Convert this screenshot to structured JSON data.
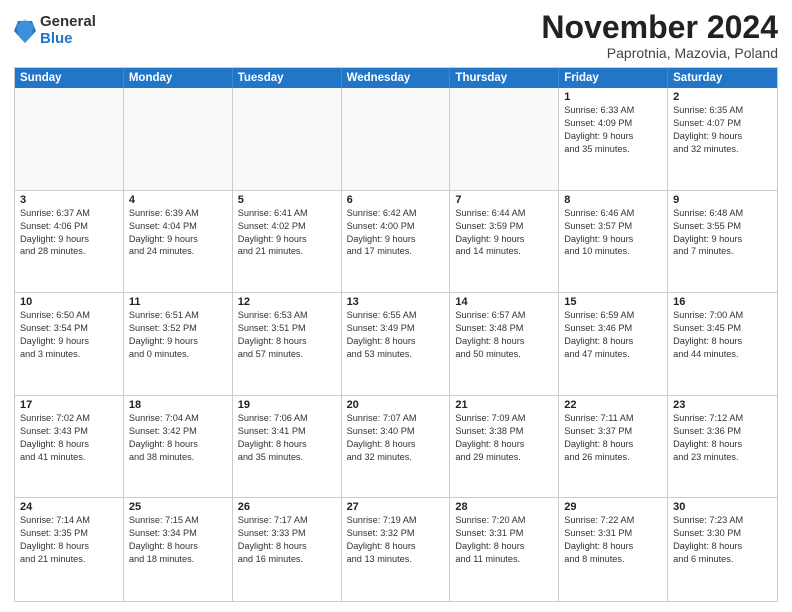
{
  "logo": {
    "general": "General",
    "blue": "Blue"
  },
  "header": {
    "month": "November 2024",
    "location": "Paprotnia, Mazovia, Poland"
  },
  "weekdays": [
    "Sunday",
    "Monday",
    "Tuesday",
    "Wednesday",
    "Thursday",
    "Friday",
    "Saturday"
  ],
  "rows": [
    [
      {
        "day": "",
        "text": "",
        "empty": true
      },
      {
        "day": "",
        "text": "",
        "empty": true
      },
      {
        "day": "",
        "text": "",
        "empty": true
      },
      {
        "day": "",
        "text": "",
        "empty": true
      },
      {
        "day": "",
        "text": "",
        "empty": true
      },
      {
        "day": "1",
        "text": "Sunrise: 6:33 AM\nSunset: 4:09 PM\nDaylight: 9 hours\nand 35 minutes.",
        "empty": false
      },
      {
        "day": "2",
        "text": "Sunrise: 6:35 AM\nSunset: 4:07 PM\nDaylight: 9 hours\nand 32 minutes.",
        "empty": false
      }
    ],
    [
      {
        "day": "3",
        "text": "Sunrise: 6:37 AM\nSunset: 4:06 PM\nDaylight: 9 hours\nand 28 minutes.",
        "empty": false
      },
      {
        "day": "4",
        "text": "Sunrise: 6:39 AM\nSunset: 4:04 PM\nDaylight: 9 hours\nand 24 minutes.",
        "empty": false
      },
      {
        "day": "5",
        "text": "Sunrise: 6:41 AM\nSunset: 4:02 PM\nDaylight: 9 hours\nand 21 minutes.",
        "empty": false
      },
      {
        "day": "6",
        "text": "Sunrise: 6:42 AM\nSunset: 4:00 PM\nDaylight: 9 hours\nand 17 minutes.",
        "empty": false
      },
      {
        "day": "7",
        "text": "Sunrise: 6:44 AM\nSunset: 3:59 PM\nDaylight: 9 hours\nand 14 minutes.",
        "empty": false
      },
      {
        "day": "8",
        "text": "Sunrise: 6:46 AM\nSunset: 3:57 PM\nDaylight: 9 hours\nand 10 minutes.",
        "empty": false
      },
      {
        "day": "9",
        "text": "Sunrise: 6:48 AM\nSunset: 3:55 PM\nDaylight: 9 hours\nand 7 minutes.",
        "empty": false
      }
    ],
    [
      {
        "day": "10",
        "text": "Sunrise: 6:50 AM\nSunset: 3:54 PM\nDaylight: 9 hours\nand 3 minutes.",
        "empty": false
      },
      {
        "day": "11",
        "text": "Sunrise: 6:51 AM\nSunset: 3:52 PM\nDaylight: 9 hours\nand 0 minutes.",
        "empty": false
      },
      {
        "day": "12",
        "text": "Sunrise: 6:53 AM\nSunset: 3:51 PM\nDaylight: 8 hours\nand 57 minutes.",
        "empty": false
      },
      {
        "day": "13",
        "text": "Sunrise: 6:55 AM\nSunset: 3:49 PM\nDaylight: 8 hours\nand 53 minutes.",
        "empty": false
      },
      {
        "day": "14",
        "text": "Sunrise: 6:57 AM\nSunset: 3:48 PM\nDaylight: 8 hours\nand 50 minutes.",
        "empty": false
      },
      {
        "day": "15",
        "text": "Sunrise: 6:59 AM\nSunset: 3:46 PM\nDaylight: 8 hours\nand 47 minutes.",
        "empty": false
      },
      {
        "day": "16",
        "text": "Sunrise: 7:00 AM\nSunset: 3:45 PM\nDaylight: 8 hours\nand 44 minutes.",
        "empty": false
      }
    ],
    [
      {
        "day": "17",
        "text": "Sunrise: 7:02 AM\nSunset: 3:43 PM\nDaylight: 8 hours\nand 41 minutes.",
        "empty": false
      },
      {
        "day": "18",
        "text": "Sunrise: 7:04 AM\nSunset: 3:42 PM\nDaylight: 8 hours\nand 38 minutes.",
        "empty": false
      },
      {
        "day": "19",
        "text": "Sunrise: 7:06 AM\nSunset: 3:41 PM\nDaylight: 8 hours\nand 35 minutes.",
        "empty": false
      },
      {
        "day": "20",
        "text": "Sunrise: 7:07 AM\nSunset: 3:40 PM\nDaylight: 8 hours\nand 32 minutes.",
        "empty": false
      },
      {
        "day": "21",
        "text": "Sunrise: 7:09 AM\nSunset: 3:38 PM\nDaylight: 8 hours\nand 29 minutes.",
        "empty": false
      },
      {
        "day": "22",
        "text": "Sunrise: 7:11 AM\nSunset: 3:37 PM\nDaylight: 8 hours\nand 26 minutes.",
        "empty": false
      },
      {
        "day": "23",
        "text": "Sunrise: 7:12 AM\nSunset: 3:36 PM\nDaylight: 8 hours\nand 23 minutes.",
        "empty": false
      }
    ],
    [
      {
        "day": "24",
        "text": "Sunrise: 7:14 AM\nSunset: 3:35 PM\nDaylight: 8 hours\nand 21 minutes.",
        "empty": false
      },
      {
        "day": "25",
        "text": "Sunrise: 7:15 AM\nSunset: 3:34 PM\nDaylight: 8 hours\nand 18 minutes.",
        "empty": false
      },
      {
        "day": "26",
        "text": "Sunrise: 7:17 AM\nSunset: 3:33 PM\nDaylight: 8 hours\nand 16 minutes.",
        "empty": false
      },
      {
        "day": "27",
        "text": "Sunrise: 7:19 AM\nSunset: 3:32 PM\nDaylight: 8 hours\nand 13 minutes.",
        "empty": false
      },
      {
        "day": "28",
        "text": "Sunrise: 7:20 AM\nSunset: 3:31 PM\nDaylight: 8 hours\nand 11 minutes.",
        "empty": false
      },
      {
        "day": "29",
        "text": "Sunrise: 7:22 AM\nSunset: 3:31 PM\nDaylight: 8 hours\nand 8 minutes.",
        "empty": false
      },
      {
        "day": "30",
        "text": "Sunrise: 7:23 AM\nSunset: 3:30 PM\nDaylight: 8 hours\nand 6 minutes.",
        "empty": false
      }
    ]
  ]
}
